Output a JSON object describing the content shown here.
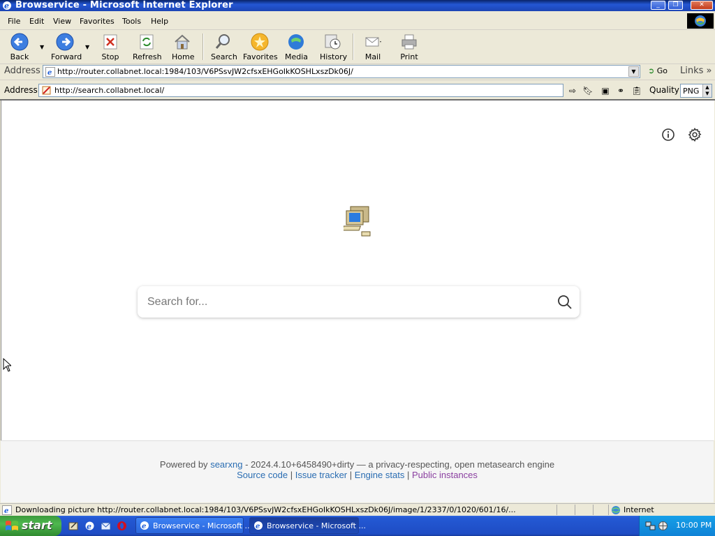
{
  "window": {
    "title": "Browservice - Microsoft Internet Explorer"
  },
  "menu": [
    "File",
    "Edit",
    "View",
    "Favorites",
    "Tools",
    "Help"
  ],
  "toolbar": {
    "back": "Back",
    "forward": "Forward",
    "stop": "Stop",
    "refresh": "Refresh",
    "home": "Home",
    "search": "Search",
    "favorites": "Favorites",
    "media": "Media",
    "history": "History",
    "mail": "Mail",
    "print": "Print"
  },
  "ie_address": {
    "label": "Address",
    "url": "http://router.collabnet.local:1984/103/V6PSsvJW2cfsxEHGoIkKOSHLxszDk06J/",
    "go": "Go",
    "links": "Links"
  },
  "bs_address": {
    "label": "Address",
    "url": "http://search.collabnet.local/",
    "quality_label": "Quality",
    "quality_value": "PNG"
  },
  "search": {
    "placeholder": "Search for..."
  },
  "footer": {
    "powered_prefix": "Powered by",
    "searxng": "searxng",
    "powered_suffix": "- 2024.4.10+6458490+dirty — a privacy-respecting, open metasearch engine",
    "source_code": "Source code",
    "issue_tracker": "Issue tracker",
    "engine_stats": "Engine stats",
    "public_instances": "Public instances",
    "divider": "|"
  },
  "status": {
    "text": "Downloading picture http://router.collabnet.local:1984/103/V6PSsvJW2cfsxEHGoIkKOSHLxszDk06J/image/1/2337/0/1020/601/16/...",
    "zone": "Internet"
  },
  "taskbar": {
    "start": "start",
    "tasks": [
      "Browservice - Microsoft ...",
      "Browservice - Microsoft ..."
    ],
    "clock": "10:00 PM"
  },
  "colors": {
    "xp_blue": "#2459d4",
    "start_green": "#3c9a3c",
    "link_blue": "#2a6db2",
    "link_purple": "#8a3fa0"
  }
}
